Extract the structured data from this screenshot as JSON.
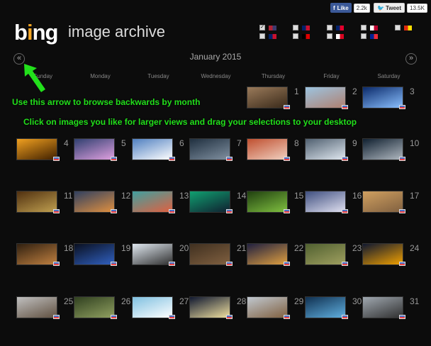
{
  "header": {
    "logo": "bing",
    "title": "image archive"
  },
  "social": {
    "like_label": "Like",
    "like_count": "2.2k",
    "tweet_label": "Tweet",
    "tweet_count": "13.5K"
  },
  "markets": [
    {
      "name": "United States",
      "checked": true,
      "colors": [
        "#b22234",
        "#3c3b6e"
      ]
    },
    {
      "name": "United Kingdom",
      "checked": false,
      "colors": [
        "#012169",
        "#c8102e"
      ]
    },
    {
      "name": "Australia",
      "checked": false,
      "colors": [
        "#012169",
        "#e4002b"
      ]
    },
    {
      "name": "Japan",
      "checked": false,
      "colors": [
        "#ffffff",
        "#bc002d"
      ]
    },
    {
      "name": "China",
      "checked": false,
      "colors": [
        "#de2910",
        "#ffde00"
      ]
    },
    {
      "name": "New Zealand",
      "checked": false,
      "colors": [
        "#012169",
        "#c8102e"
      ]
    },
    {
      "name": "Germany",
      "checked": false,
      "colors": [
        "#000000",
        "#dd0000"
      ]
    },
    {
      "name": "Canada",
      "checked": false,
      "colors": [
        "#ffffff",
        "#d80621"
      ]
    },
    {
      "name": "France",
      "checked": false,
      "colors": [
        "#002395",
        "#ed2939"
      ]
    }
  ],
  "calendar": {
    "month": "January 2015",
    "prev_label": "«",
    "next_label": "»",
    "days_of_week": [
      "Sunday",
      "Monday",
      "Tuesday",
      "Wednesday",
      "Thursday",
      "Friday",
      "Saturday"
    ],
    "first_weekday": 4,
    "days": [
      {
        "n": "1",
        "c": [
          "#9a7a5a",
          "#3a2a1a"
        ]
      },
      {
        "n": "2",
        "c": [
          "#9cc4e0",
          "#b08070"
        ]
      },
      {
        "n": "3",
        "c": [
          "#0b2a6a",
          "#8ac0ff"
        ]
      },
      {
        "n": "4",
        "c": [
          "#f0a020",
          "#402000"
        ]
      },
      {
        "n": "5",
        "c": [
          "#304070",
          "#e0a0e0"
        ]
      },
      {
        "n": "6",
        "c": [
          "#5080c0",
          "#ffffff"
        ]
      },
      {
        "n": "7",
        "c": [
          "#203040",
          "#8090a0"
        ]
      },
      {
        "n": "8",
        "c": [
          "#c05030",
          "#f0d0c0"
        ]
      },
      {
        "n": "9",
        "c": [
          "#506070",
          "#e0e8f0"
        ]
      },
      {
        "n": "10",
        "c": [
          "#102030",
          "#b0b8c0"
        ]
      },
      {
        "n": "11",
        "c": [
          "#503010",
          "#c0a050"
        ]
      },
      {
        "n": "12",
        "c": [
          "#304060",
          "#e09040"
        ]
      },
      {
        "n": "13",
        "c": [
          "#40a0a0",
          "#e06040"
        ]
      },
      {
        "n": "14",
        "c": [
          "#10a070",
          "#102030"
        ]
      },
      {
        "n": "15",
        "c": [
          "#204010",
          "#80c040"
        ]
      },
      {
        "n": "16",
        "c": [
          "#405080",
          "#e0e0f0"
        ]
      },
      {
        "n": "17",
        "c": [
          "#d0a060",
          "#806040"
        ]
      },
      {
        "n": "18",
        "c": [
          "#302010",
          "#c08040"
        ]
      },
      {
        "n": "19",
        "c": [
          "#0a1020",
          "#3060c0"
        ]
      },
      {
        "n": "20",
        "c": [
          "#e0e8f0",
          "#303030"
        ]
      },
      {
        "n": "21",
        "c": [
          "#403020",
          "#806040"
        ]
      },
      {
        "n": "22",
        "c": [
          "#202040",
          "#e0a040"
        ]
      },
      {
        "n": "23",
        "c": [
          "#506030",
          "#a0a060"
        ]
      },
      {
        "n": "24",
        "c": [
          "#101830",
          "#f0a000"
        ]
      },
      {
        "n": "25",
        "c": [
          "#c0c0c0",
          "#605040"
        ]
      },
      {
        "n": "26",
        "c": [
          "#304020",
          "#90a060"
        ]
      },
      {
        "n": "27",
        "c": [
          "#80c0e0",
          "#ffffff"
        ]
      },
      {
        "n": "28",
        "c": [
          "#101830",
          "#f0e0a0"
        ]
      },
      {
        "n": "29",
        "c": [
          "#c0c8d0",
          "#806040"
        ]
      },
      {
        "n": "30",
        "c": [
          "#103050",
          "#60b0e0"
        ]
      },
      {
        "n": "31",
        "c": [
          "#a0a8b0",
          "#303030"
        ]
      }
    ]
  },
  "annotations": {
    "arrow_note": "Use this arrow to browse backwards by month",
    "click_note": "Click on images you like for larger views and drag your selections to your desktop",
    "color": "#22e01b"
  }
}
